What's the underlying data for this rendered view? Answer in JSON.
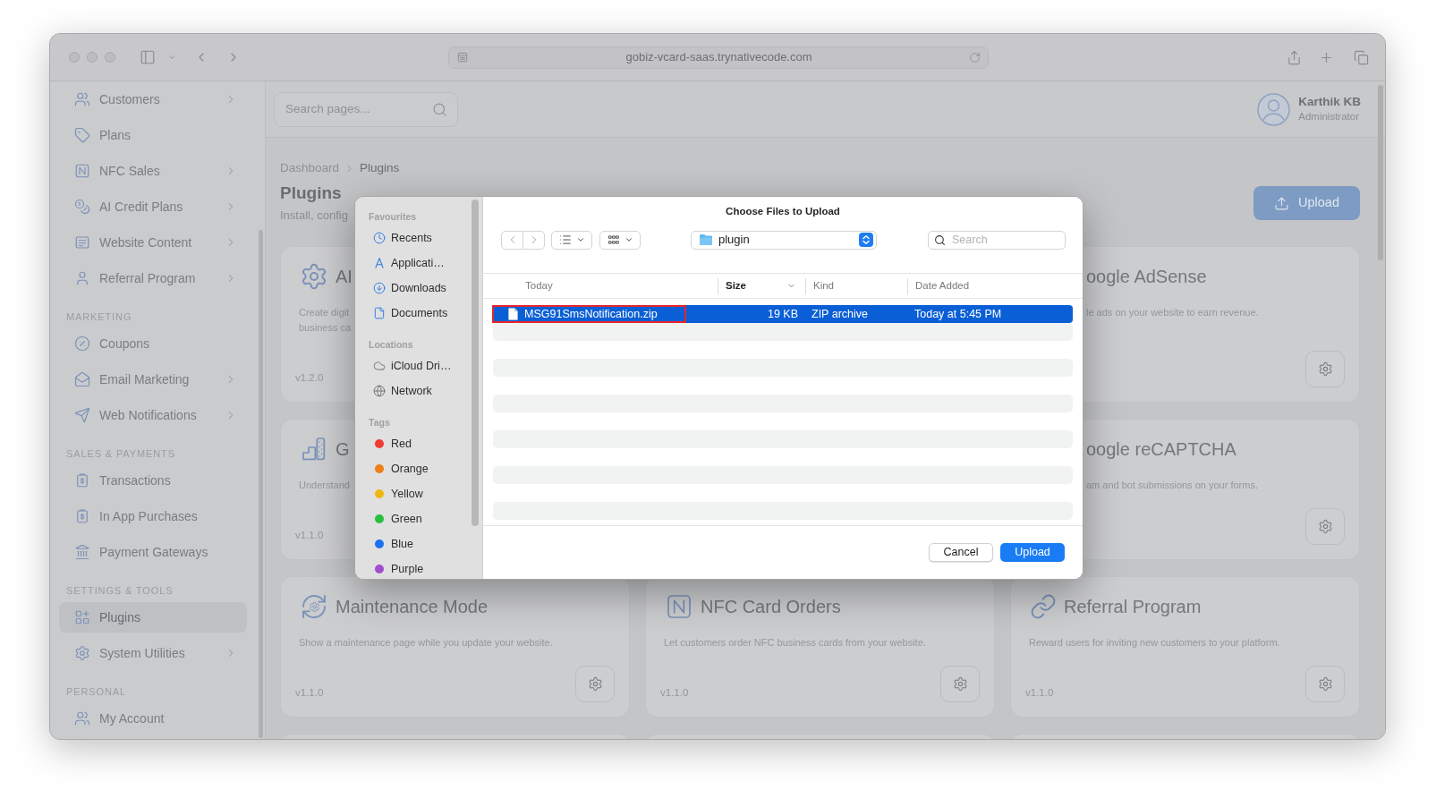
{
  "browser": {
    "url": "gobiz-vcard-saas.trynativecode.com"
  },
  "sidebar": {
    "groups": [
      {
        "items": [
          {
            "label": "Customers",
            "expandable": true,
            "selected": false
          },
          {
            "label": "Plans",
            "expandable": false,
            "selected": false
          },
          {
            "label": "NFC Sales",
            "expandable": true,
            "selected": false
          },
          {
            "label": "AI Credit Plans",
            "expandable": true,
            "selected": false
          },
          {
            "label": "Website Content",
            "expandable": true,
            "selected": false
          },
          {
            "label": "Referral Program",
            "expandable": true,
            "selected": false
          }
        ]
      },
      {
        "heading": "MARKETING",
        "items": [
          {
            "label": "Coupons",
            "expandable": false,
            "selected": false
          },
          {
            "label": "Email Marketing",
            "expandable": true,
            "selected": false
          },
          {
            "label": "Web Notifications",
            "expandable": true,
            "selected": false
          }
        ]
      },
      {
        "heading": "SALES & PAYMENTS",
        "items": [
          {
            "label": "Transactions",
            "expandable": false,
            "selected": false
          },
          {
            "label": "In App Purchases",
            "expandable": false,
            "selected": false
          },
          {
            "label": "Payment Gateways",
            "expandable": false,
            "selected": false
          }
        ]
      },
      {
        "heading": "SETTINGS & TOOLS",
        "items": [
          {
            "label": "Plugins",
            "expandable": false,
            "selected": true
          },
          {
            "label": "System Utilities",
            "expandable": true,
            "selected": false
          }
        ]
      },
      {
        "heading": "PERSONAL",
        "items": [
          {
            "label": "My Account",
            "expandable": false,
            "selected": false
          }
        ]
      }
    ]
  },
  "header": {
    "search": {
      "placeholder": "Search pages..."
    },
    "user": {
      "name": "Karthik KB",
      "role": "Administrator"
    }
  },
  "page": {
    "breadcrumb": [
      "Dashboard",
      "Plugins"
    ],
    "title": "Plugins",
    "subtitle": "Install, config",
    "upload_button": "Upload"
  },
  "plugin_rows": [
    [
      {
        "kind": "cut_right",
        "title": "AI",
        "description_lines": [
          "Create digit",
          "business ca"
        ],
        "version": "v1.2.0"
      },
      null,
      {
        "kind": "cut_left",
        "title": "oogle AdSense",
        "description_lines": [
          "le ads on your website to earn revenue."
        ]
      }
    ],
    [
      {
        "kind": "cut_right",
        "title": "G",
        "description_lines": [
          "Understand"
        ],
        "version": "v1.1.0"
      },
      null,
      {
        "kind": "cut_left",
        "title": "oogle reCAPTCHA",
        "description_lines": [
          "am and bot submissions on your forms."
        ]
      }
    ],
    [
      {
        "kind": "full",
        "title": "Maintenance Mode",
        "description_lines": [
          "Show a maintenance page while you update your website."
        ],
        "version": "v1.1.0"
      },
      {
        "kind": "full",
        "title": "NFC Card Orders",
        "description_lines": [
          "Let customers order NFC business cards from your website."
        ],
        "version": "v1.1.0"
      },
      {
        "kind": "full",
        "title": "Referral Program",
        "description_lines": [
          "Reward users for inviting new customers to your platform."
        ],
        "version": "v1.1.0"
      }
    ],
    [
      {
        "kind": "cut_bottom"
      },
      {
        "kind": "cut_bottom"
      },
      {
        "kind": "cut_bottom"
      }
    ]
  ],
  "file_dialog": {
    "title": "Choose Files to Upload",
    "sidebar": [
      {
        "heading": "Favourites",
        "items": [
          {
            "label": "Recents"
          },
          {
            "label": "Applicati…"
          },
          {
            "label": "Downloads"
          },
          {
            "label": "Documents"
          }
        ]
      },
      {
        "heading": "Locations",
        "items": [
          {
            "label": "iCloud Dri…"
          },
          {
            "label": "Network"
          }
        ]
      },
      {
        "heading": "Tags",
        "items": [
          {
            "label": "Red",
            "color": "#f13a32"
          },
          {
            "label": "Orange",
            "color": "#ef7f16"
          },
          {
            "label": "Yellow",
            "color": "#edb70e"
          },
          {
            "label": "Green",
            "color": "#29c03e"
          },
          {
            "label": "Blue",
            "color": "#1b72ef"
          },
          {
            "label": "Purple",
            "color": "#a04ecf"
          }
        ]
      }
    ],
    "location": "plugin",
    "search": {
      "placeholder": "Search"
    },
    "columns": [
      {
        "label": "Today",
        "sorted": false
      },
      {
        "label": "Size",
        "sorted": true
      },
      {
        "label": "Kind",
        "sorted": false
      },
      {
        "label": "Date Added",
        "sorted": false
      }
    ],
    "files": [
      {
        "name": "MSG91SmsNotification.zip",
        "size": "19 KB",
        "file_kind": "ZIP archive",
        "date_added": "Today at 5:45 PM",
        "selected": true,
        "highlighted": true
      }
    ],
    "buttons": {
      "cancel": "Cancel",
      "confirm": "Upload"
    }
  }
}
